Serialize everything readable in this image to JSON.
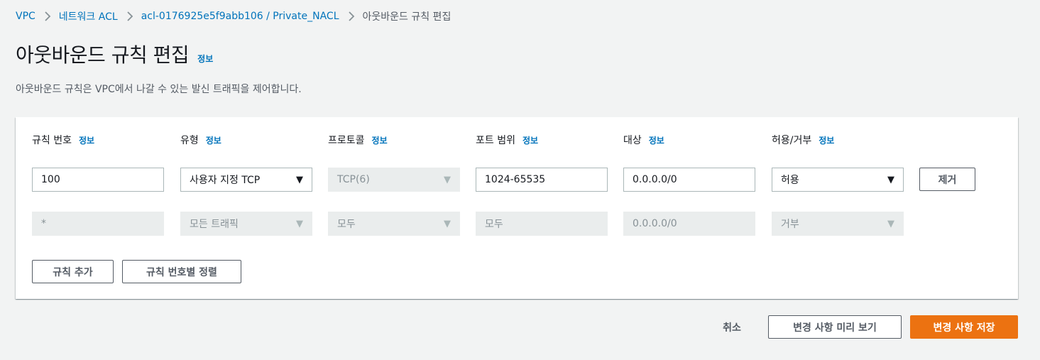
{
  "breadcrumb": {
    "items": [
      "VPC",
      "네트워크 ACL",
      "acl-0176925e5f9abb106 / Private_NACL",
      "아웃바운드 규칙 편집"
    ]
  },
  "page": {
    "title": "아웃바운드 규칙 편집",
    "title_info": "정보",
    "description": "아웃바운드 규칙은 VPC에서 나갈 수 있는 발신 트래픽을 제어합니다."
  },
  "columns": [
    {
      "label": "규칙 번호",
      "info": "정보"
    },
    {
      "label": "유형",
      "info": "정보"
    },
    {
      "label": "프로토콜",
      "info": "정보"
    },
    {
      "label": "포트 범위",
      "info": "정보"
    },
    {
      "label": "대상",
      "info": "정보"
    },
    {
      "label": "허용/거부",
      "info": "정보"
    }
  ],
  "rule_row": {
    "rule_number": "100",
    "type": "사용자 지정 TCP",
    "protocol": "TCP(6)",
    "port_range": "1024-65535",
    "destination": "0.0.0.0/0",
    "allow_deny": "허용",
    "remove_label": "제거"
  },
  "default_row": {
    "rule_number": "*",
    "type": "모든 트래픽",
    "protocol": "모두",
    "port_range": "모두",
    "destination": "0.0.0.0/0",
    "allow_deny": "거부"
  },
  "actions": {
    "add_rule": "규칙 추가",
    "sort_by_rule_number": "규칙 번호별 정렬"
  },
  "footer": {
    "cancel": "취소",
    "preview": "변경 사항 미리 보기",
    "save": "변경 사항 저장"
  },
  "icons": {
    "caret": "▼",
    "breadcrumb_separator": "chevron-right-icon"
  },
  "colors": {
    "link": "#0073bb",
    "primary_button": "#ec7211",
    "background": "#f2f3f3",
    "disabled_field": "#eaeded"
  }
}
